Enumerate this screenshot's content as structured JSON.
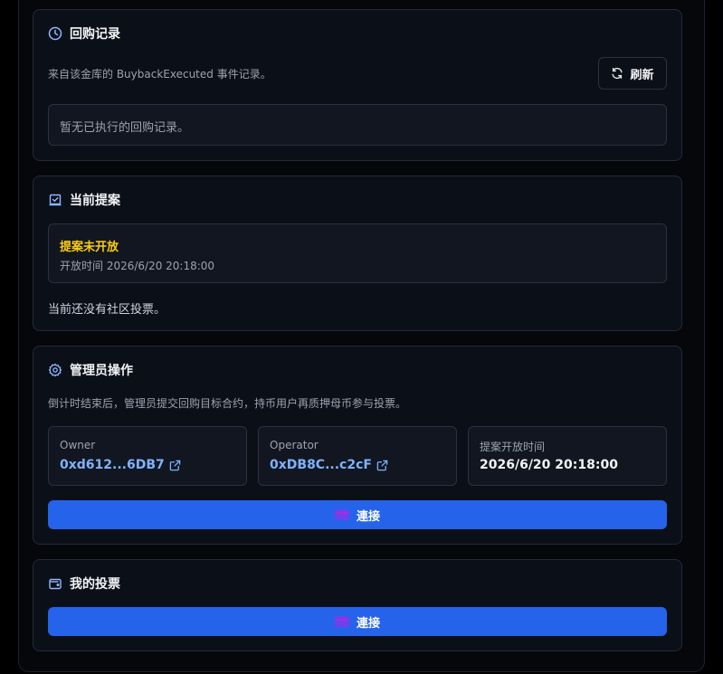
{
  "buyback": {
    "title": "回购记录",
    "description": "来自该金库的 BuybackExecuted 事件记录。",
    "refresh_label": "刷新",
    "empty_text": "暂无已执行的回购记录。"
  },
  "proposal": {
    "title": "当前提案",
    "status": "提案未开放",
    "open_time_text": "开放时间 2026/6/20 20:18:00",
    "no_votes_text": "当前还没有社区投票。",
    "status_color": "#facc15"
  },
  "admin": {
    "title": "管理员操作",
    "description": "倒计时结束后，管理员提交回购目标合约，持币用户再质押母币参与投票。",
    "owner_label": "Owner",
    "owner_value": "0xd612...6DB7",
    "operator_label": "Operator",
    "operator_value": "0xDB8C...c2cF",
    "open_time_label": "提案开放时间",
    "open_time_value": "2026/6/20 20:18:00",
    "connect_label": "連接"
  },
  "my_votes": {
    "title": "我的投票",
    "connect_label": "連接"
  },
  "colors": {
    "accent": "#2563eb",
    "link": "#7fb2ff",
    "warning": "#facc15"
  }
}
